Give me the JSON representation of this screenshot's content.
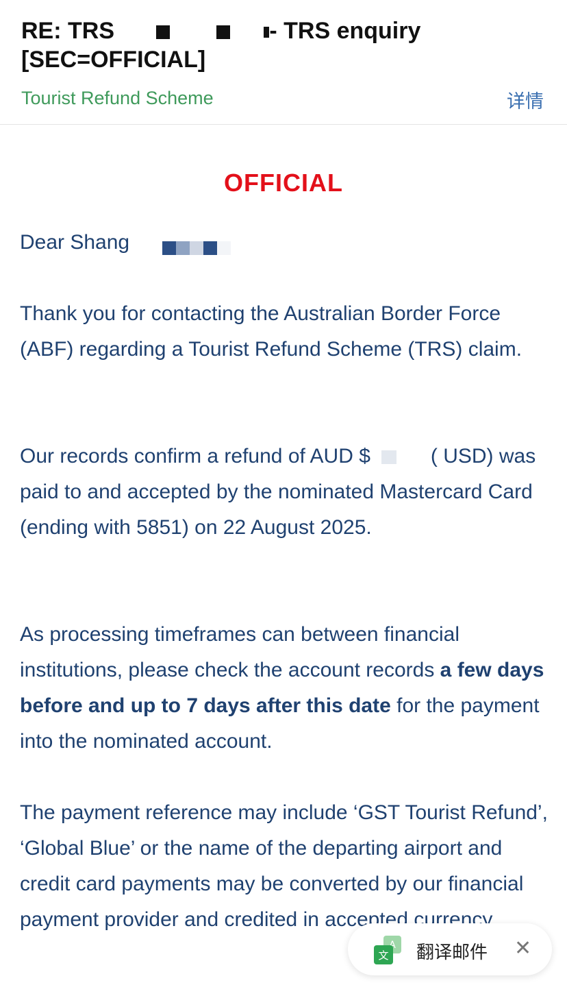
{
  "header": {
    "subject_part1": "RE: TRS",
    "subject_part2": "- TRS enquiry",
    "subject_line2": "[SEC=OFFICIAL]",
    "sender": "Tourist Refund Scheme",
    "details_link": "详情"
  },
  "banner": {
    "classification": "OFFICIAL"
  },
  "message": {
    "greeting": "Dear Shang",
    "para1": "Thank you for contacting the Australian Border Force (ABF) regarding a Tourist Refund Scheme (TRS) claim.",
    "para2_a": "Our records confirm a refund of AUD $",
    "para2_b": "(",
    "para2_c": "USD) was paid to and accepted by the nominated Mastercard Card (ending with 5851) on 22 August 2025.",
    "para3_a": "As processing timeframes can between financial institutions, please check the account records ",
    "para3_bold": "a few days before and up to 7 days after this date",
    "para3_b": " for the payment into the nominated account.",
    "para4": "The payment reference may include ‘GST Tourist Refund’, ‘Global Blue’ or the name of the departing airport and credit card payments may be converted by our financial payment provider and credited in accepted currency."
  },
  "translate": {
    "label": "翻译邮件",
    "icon": "translate-icon",
    "close_icon": "close-icon"
  },
  "colors": {
    "body_text": "#1f4170",
    "official_red": "#e3101a",
    "sender_green": "#3f9a5b",
    "link_blue": "#3a6fb0"
  }
}
